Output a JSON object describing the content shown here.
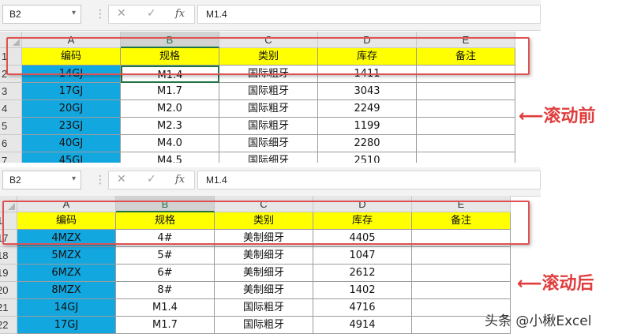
{
  "panels": [
    {
      "name_box": "B2",
      "formula": "M1.4",
      "row_numbers": [
        "1",
        "2",
        "3",
        "4",
        "5",
        "6",
        "7"
      ],
      "header": [
        "编码",
        "规格",
        "类别",
        "库存",
        "备注"
      ],
      "rows": [
        [
          "14GJ",
          "M1.4",
          "国际粗牙",
          "1411",
          ""
        ],
        [
          "17GJ",
          "M1.7",
          "国际粗牙",
          "3043",
          ""
        ],
        [
          "20GJ",
          "M2.0",
          "国际粗牙",
          "2249",
          ""
        ],
        [
          "23GJ",
          "M2.3",
          "国际粗牙",
          "1199",
          ""
        ],
        [
          "40GJ",
          "M4.0",
          "国际细牙",
          "2280",
          ""
        ],
        [
          "45GJ",
          "M4.5",
          "国际细牙",
          "2510",
          ""
        ]
      ],
      "label": "滚动前"
    },
    {
      "name_box": "B2",
      "formula": "M1.4",
      "row_numbers": [
        "1",
        "17",
        "18",
        "19",
        "20",
        "21",
        "22"
      ],
      "header": [
        "编码",
        "规格",
        "类别",
        "库存",
        "备注"
      ],
      "rows": [
        [
          "4MZX",
          "4#",
          "美制细牙",
          "4405",
          ""
        ],
        [
          "5MZX",
          "5#",
          "美制细牙",
          "1047",
          ""
        ],
        [
          "6MZX",
          "6#",
          "美制细牙",
          "2612",
          ""
        ],
        [
          "8MZX",
          "8#",
          "美制细牙",
          "1402",
          ""
        ],
        [
          "14GJ",
          "M1.4",
          "国际粗牙",
          "4716",
          ""
        ],
        [
          "17GJ",
          "M1.7",
          "国际粗牙",
          "4914",
          ""
        ]
      ],
      "label": "滚动后"
    }
  ],
  "columns": [
    "A",
    "B",
    "C",
    "D",
    "E"
  ],
  "toolbar": {
    "cancel_glyph": "✕",
    "enter_glyph": "✓",
    "fx_label": "fx"
  },
  "watermark": "头条 @小楸Excel",
  "colors": {
    "header_fill": "#ffff00",
    "code_fill": "#13a7e0",
    "highlight_box": "#e05252",
    "arrow": "#e03c3c",
    "selection": "#217346"
  }
}
